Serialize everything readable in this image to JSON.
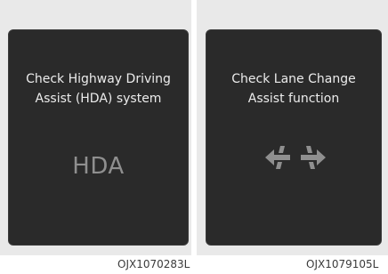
{
  "panels": [
    {
      "message_line1": "Check Highway Driving",
      "message_line2": "Assist (HDA) system",
      "logo_text": "HDA",
      "code": "OJX1070283L"
    },
    {
      "message_line1": "Check Lane Change",
      "message_line2": "Assist function",
      "icon": "lane-change-assist-icon",
      "code": "OJX1079105L"
    }
  ],
  "colors": {
    "screen": "#2a2a2a",
    "text": "#ececec",
    "icon": "#8f8f8f",
    "frame": "#e9e9e9"
  }
}
